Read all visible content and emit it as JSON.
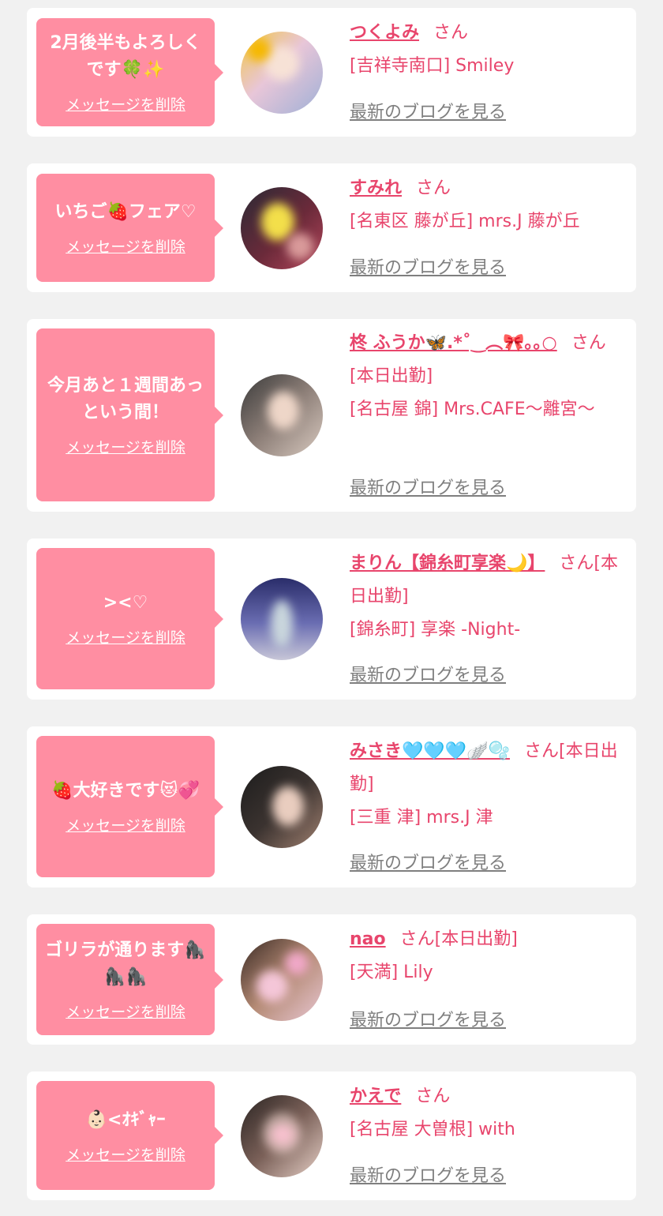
{
  "common": {
    "delete_label": "メッセージを削除",
    "blog_label": "最新のブログを見る",
    "honorific": "さん",
    "accent_color": "#e8456c",
    "bubble_color": "#ff8ea2"
  },
  "cards": [
    {
      "message": "2月後半もよろしくです🍀✨",
      "name": "つくよみ",
      "suffix": "",
      "shop": "[吉祥寺南口] Smiley"
    },
    {
      "message": "いちご🍓フェア♡",
      "name": "すみれ",
      "suffix": "",
      "shop": "[名東区 藤が丘] mrs.J 藤が丘"
    },
    {
      "message": "今月あと１週間あっという間！",
      "name": "柊 ふうか🦋.*˚‿︵🎀｡｡○",
      "suffix": "[本日出勤]",
      "shop": "[名古屋 錦] Mrs.CAFE〜離宮〜"
    },
    {
      "message": "><♡",
      "name": "まりん【錦糸町享楽🌙】",
      "suffix": "[本日出勤]",
      "shop": "[錦糸町] 享楽 -Night-"
    },
    {
      "message": "🍓大好きです😻💞",
      "name": "みさき🩵🩵🩵🪽🫧",
      "suffix": "[本日出勤]",
      "shop": "[三重 津] mrs.J 津"
    },
    {
      "message": "ゴリラが通ります🦍🦍🦍",
      "name": "nao",
      "suffix": "[本日出勤]",
      "shop": "[天満] Lily"
    },
    {
      "message": "👶🏻<ｵｷﾞｬｰ",
      "name": "かえで",
      "suffix": "",
      "shop": "[名古屋 大曽根] with"
    }
  ]
}
